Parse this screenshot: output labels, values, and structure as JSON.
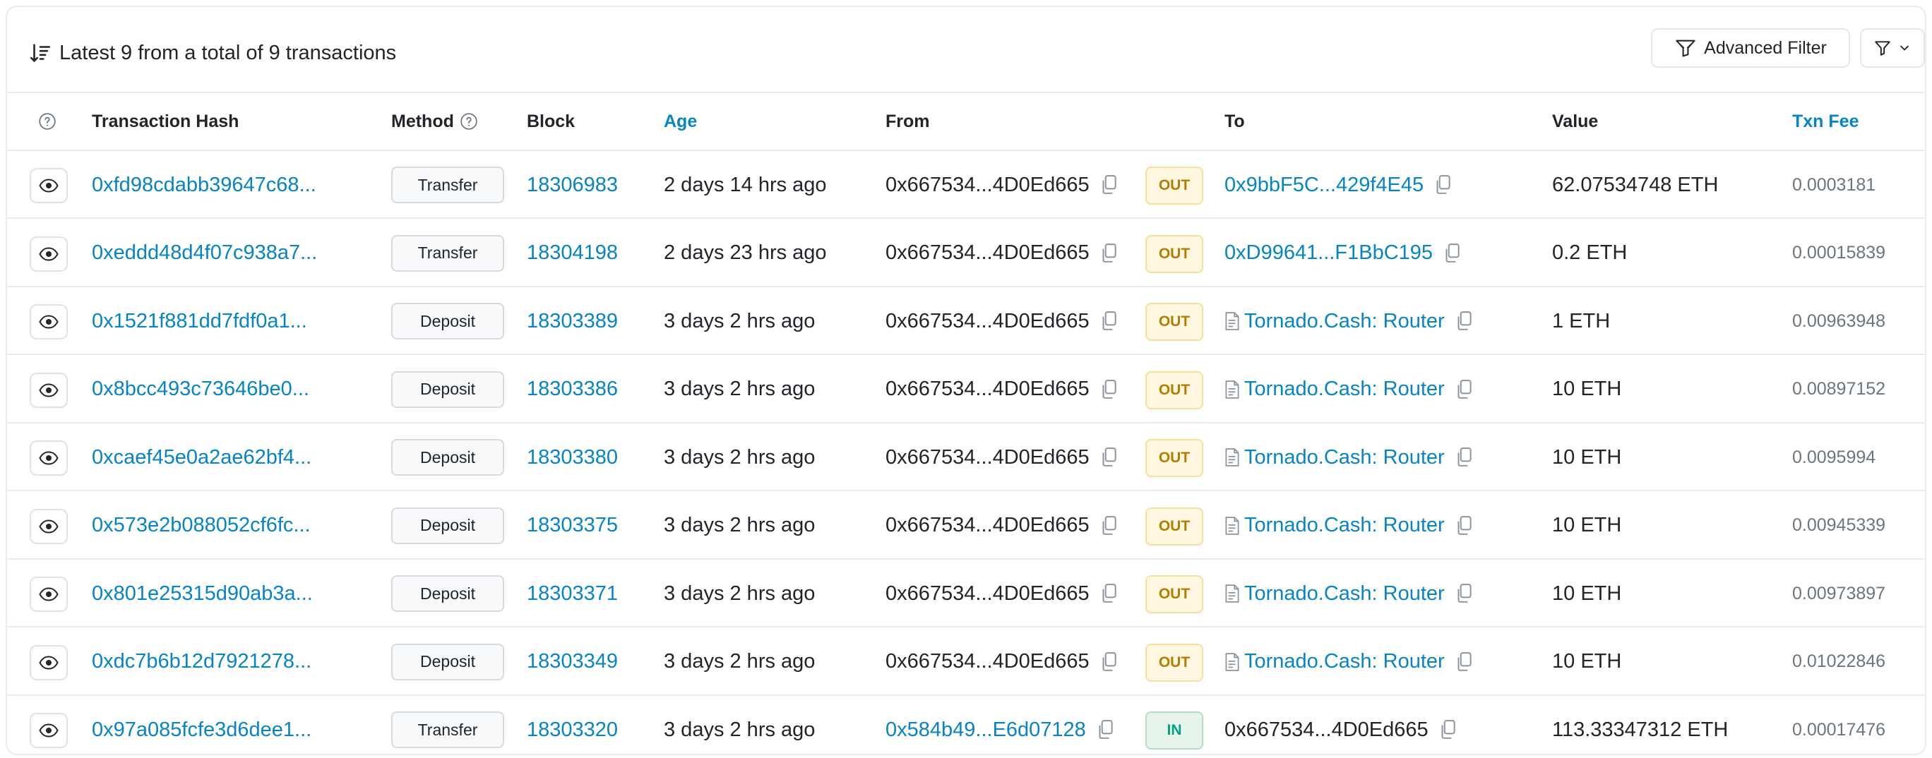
{
  "header": {
    "summary": "Latest 9 from a total of 9 transactions",
    "advanced_filter_label": "Advanced Filter"
  },
  "columns": {
    "txn_hash": "Transaction Hash",
    "method": "Method",
    "block": "Block",
    "age": "Age",
    "from": "From",
    "to": "To",
    "value": "Value",
    "txn_fee": "Txn Fee"
  },
  "rows": [
    {
      "hash": "0xfd98cdabb39647c68...",
      "method": "Transfer",
      "block": "18306983",
      "age": "2 days 14 hrs ago",
      "from": "0x667534...4D0Ed665",
      "direction": "OUT",
      "to": "0x9bbF5C...429f4E45",
      "to_is_contract": false,
      "value": "62.07534748 ETH",
      "fee": "0.0003181"
    },
    {
      "hash": "0xeddd48d4f07c938a7...",
      "method": "Transfer",
      "block": "18304198",
      "age": "2 days 23 hrs ago",
      "from": "0x667534...4D0Ed665",
      "direction": "OUT",
      "to": "0xD99641...F1BbC195",
      "to_is_contract": false,
      "value": "0.2 ETH",
      "fee": "0.00015839"
    },
    {
      "hash": "0x1521f881dd7fdf0a1...",
      "method": "Deposit",
      "block": "18303389",
      "age": "3 days 2 hrs ago",
      "from": "0x667534...4D0Ed665",
      "direction": "OUT",
      "to": "Tornado.Cash: Router",
      "to_is_contract": true,
      "value": "1 ETH",
      "fee": "0.00963948"
    },
    {
      "hash": "0x8bcc493c73646be0...",
      "method": "Deposit",
      "block": "18303386",
      "age": "3 days 2 hrs ago",
      "from": "0x667534...4D0Ed665",
      "direction": "OUT",
      "to": "Tornado.Cash: Router",
      "to_is_contract": true,
      "value": "10 ETH",
      "fee": "0.00897152"
    },
    {
      "hash": "0xcaef45e0a2ae62bf4...",
      "method": "Deposit",
      "block": "18303380",
      "age": "3 days 2 hrs ago",
      "from": "0x667534...4D0Ed665",
      "direction": "OUT",
      "to": "Tornado.Cash: Router",
      "to_is_contract": true,
      "value": "10 ETH",
      "fee": "0.0095994"
    },
    {
      "hash": "0x573e2b088052cf6fc...",
      "method": "Deposit",
      "block": "18303375",
      "age": "3 days 2 hrs ago",
      "from": "0x667534...4D0Ed665",
      "direction": "OUT",
      "to": "Tornado.Cash: Router",
      "to_is_contract": true,
      "value": "10 ETH",
      "fee": "0.00945339"
    },
    {
      "hash": "0x801e25315d90ab3a...",
      "method": "Deposit",
      "block": "18303371",
      "age": "3 days 2 hrs ago",
      "from": "0x667534...4D0Ed665",
      "direction": "OUT",
      "to": "Tornado.Cash: Router",
      "to_is_contract": true,
      "value": "10 ETH",
      "fee": "0.00973897"
    },
    {
      "hash": "0xdc7b6b12d7921278...",
      "method": "Deposit",
      "block": "18303349",
      "age": "3 days 2 hrs ago",
      "from": "0x667534...4D0Ed665",
      "direction": "OUT",
      "to": "Tornado.Cash: Router",
      "to_is_contract": true,
      "value": "10 ETH",
      "fee": "0.01022846"
    },
    {
      "hash": "0x97a085fcfe3d6dee1...",
      "method": "Transfer",
      "block": "18303320",
      "age": "3 days 2 hrs ago",
      "from": "0x584b49...E6d07128",
      "direction": "IN",
      "to": "0x667534...4D0Ed665",
      "to_is_contract": false,
      "value": "113.33347312 ETH",
      "fee": "0.00017476"
    }
  ]
}
